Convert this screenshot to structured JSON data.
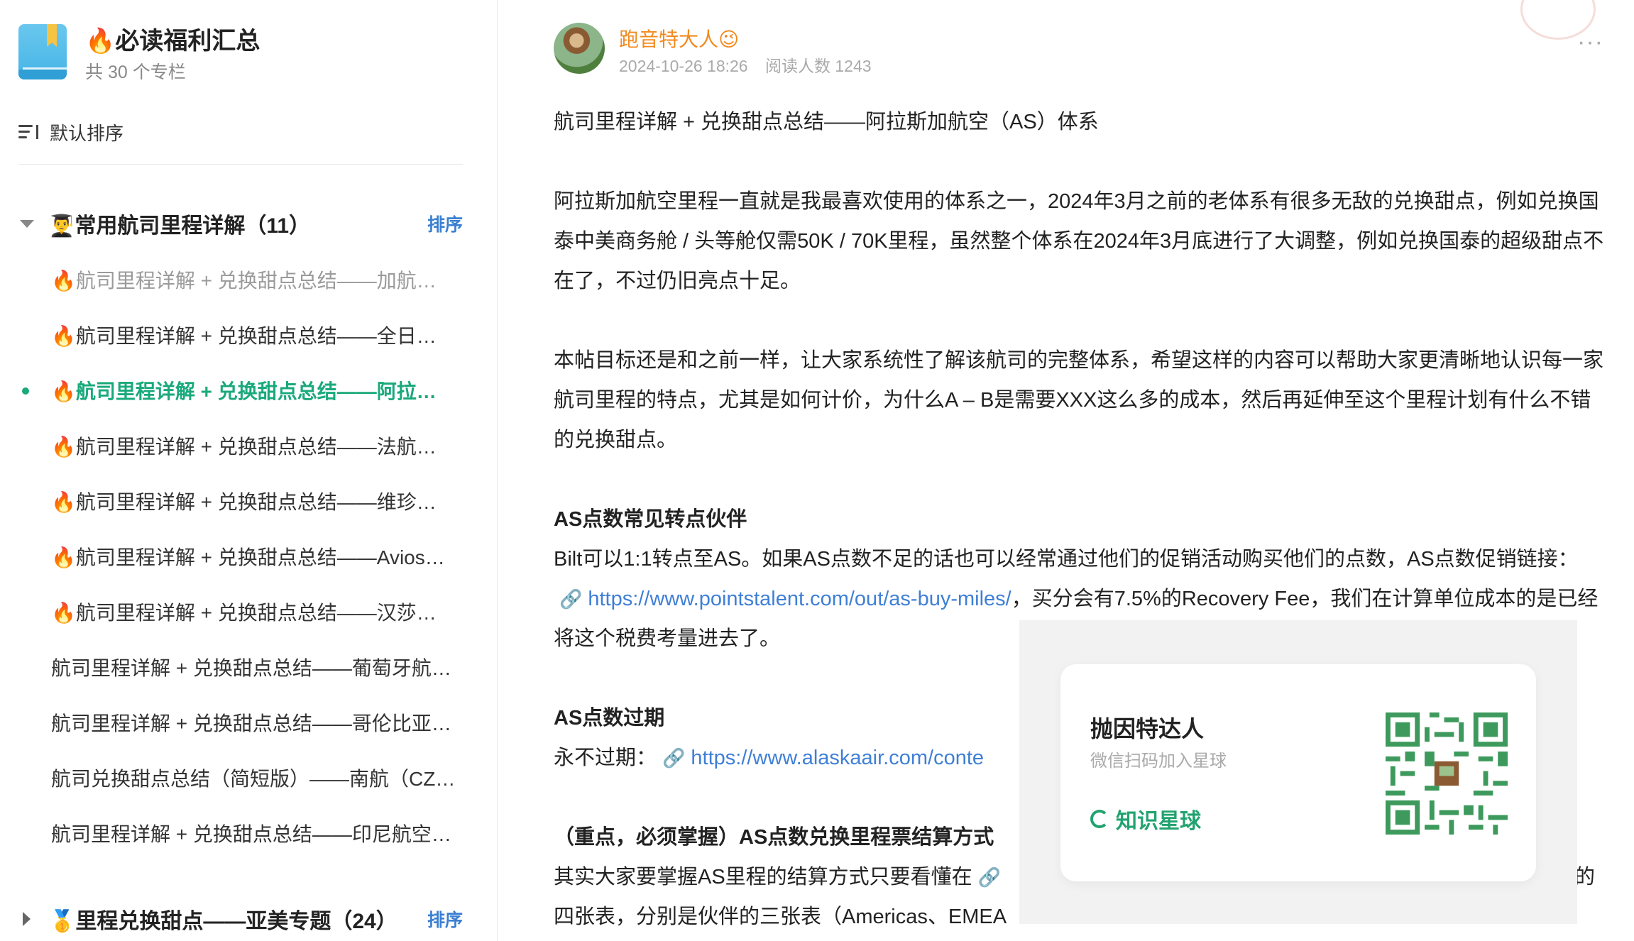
{
  "sidebar": {
    "column_title": "🔥必读福利汇总",
    "column_count": "共 30 个专栏",
    "sort_label": "默认排序",
    "groups": [
      {
        "title": "👨‍🎓常用航司里程详解（11）",
        "sort_label": "排序",
        "expanded": true,
        "items": [
          {
            "label": "🔥航司里程详解 + 兑换甜点总结——加航（…",
            "state": "read"
          },
          {
            "label": "🔥航司里程详解 + 兑换甜点总结——全日空…",
            "state": "normal"
          },
          {
            "label": "🔥航司里程详解 + 兑换甜点总结——阿拉斯…",
            "state": "active"
          },
          {
            "label": "🔥航司里程详解 + 兑换甜点总结——法航荷…",
            "state": "normal"
          },
          {
            "label": "🔥航司里程详解 + 兑换甜点总结——维珍航…",
            "state": "normal"
          },
          {
            "label": "🔥航司里程详解 + 兑换甜点总结——Avios…",
            "state": "normal"
          },
          {
            "label": "🔥航司里程详解 + 兑换甜点总结——汉莎（…",
            "state": "normal"
          },
          {
            "label": "航司里程详解 + 兑换甜点总结——葡萄牙航…",
            "state": "normal"
          },
          {
            "label": "航司里程详解 + 兑换甜点总结——哥伦比亚…",
            "state": "normal"
          },
          {
            "label": "航司兑换甜点总结（简短版）——南航（CZ…",
            "state": "normal"
          },
          {
            "label": "航司里程详解 + 兑换甜点总结——印尼航空…",
            "state": "normal"
          }
        ]
      },
      {
        "title": "🥇里程兑换甜点——亚美专题（24）",
        "sort_label": "排序",
        "expanded": false,
        "items": []
      }
    ]
  },
  "post": {
    "author": "跑音特大人😉",
    "date": "2024-10-26 18:26",
    "read_count": "阅读人数 1243",
    "title_line": "航司里程详解 + 兑换甜点总结——阿拉斯加航空（AS）体系",
    "para1": "阿拉斯加航空里程一直就是我最喜欢使用的体系之一，2024年3月之前的老体系有很多无敌的兑换甜点，例如兑换国泰中美商务舱 / 头等舱仅需50K / 70K里程，虽然整个体系在2024年3月底进行了大调整，例如兑换国泰的超级甜点不在了，不过仍旧亮点十足。",
    "para2": "本帖目标还是和之前一样，让大家系统性了解该航司的完整体系，希望这样的内容可以帮助大家更清晰地认识每一家航司里程的特点，尤其是如何计价，为什么A – B是需要XXX这么多的成本，然后再延伸至这个里程计划有什么不错的兑换甜点。",
    "h1": "AS点数常见转点伙伴",
    "para3_a": "Bilt可以1:1转点至AS。如果AS点数不足的话也可以经常通过他们的促销活动购买他们的点数，AS点数促销链接：",
    "para3_link": "https://www.pointstalent.com/out/as-buy-miles/",
    "para3_b": "，买分会有7.5%的Recovery Fee，我们在计算单位成本的是已经将这个税费考量进去了。",
    "h2": "AS点数过期",
    "para4_a": "永不过期：",
    "para4_link": "https://www.alaskaair.com/conte",
    "h3": "（重点，必须掌握）AS点数兑换里程票结算方式",
    "para5_a": "其实大家要掌握AS里程的结算方式只要看懂在",
    "para5_tail": "的",
    "para6": "四张表，分别是伙伴的三张表（Americas、EMEA"
  },
  "qr_card": {
    "title": "抛因特达人",
    "subtitle": "微信扫码加入星球",
    "brand": "知识星球"
  },
  "colors": {
    "active": "#1aa97b",
    "author": "#f28a1e",
    "link": "#3f7fd6",
    "sort_link": "#3b7fd0",
    "brand": "#21a36f"
  }
}
